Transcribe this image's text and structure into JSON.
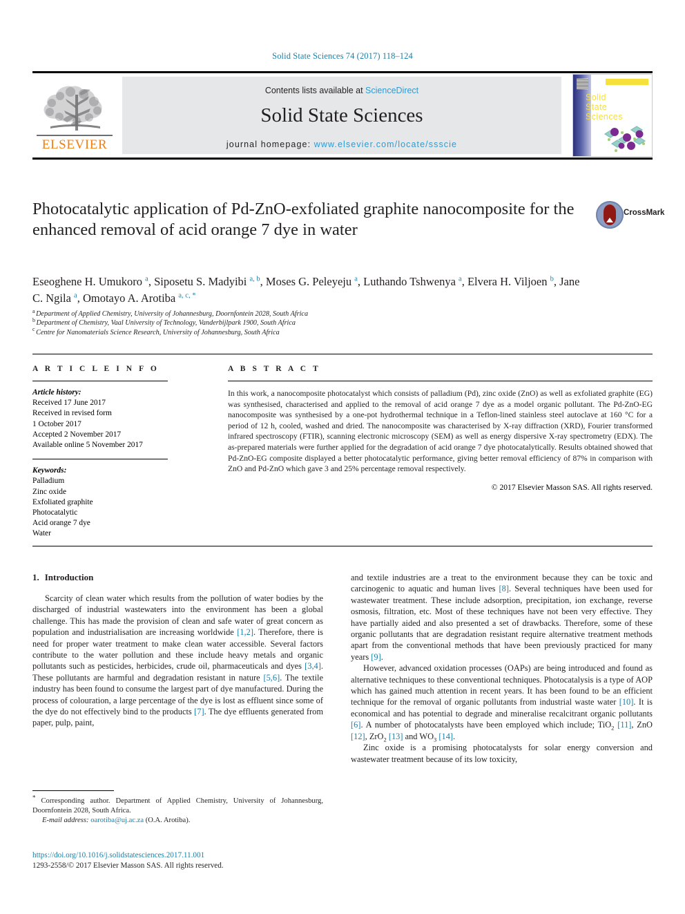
{
  "running_head": "Solid State Sciences 74 (2017) 118–124",
  "masthead": {
    "contents_label": "Contents lists available at ",
    "sciencedirect": "ScienceDirect",
    "journal_name": "Solid State Sciences",
    "homepage_label": "journal homepage: ",
    "homepage_url": "www.elsevier.com/locate/ssscie",
    "publisher_wordmark": "ELSEVIER",
    "cover_title_line1": "Solid",
    "cover_title_line2": "State",
    "cover_title_line3": "Sciences"
  },
  "badge": {
    "crossmark_label": "CrossMark"
  },
  "article": {
    "title": "Photocatalytic application of Pd-ZnO-exfoliated graphite nanocomposite for the enhanced removal of acid orange 7 dye in water",
    "authors_line1": "Eseoghene H. Umukoro",
    "authors_html": "Eseoghene H. Umukoro <sup>a</sup>, Siposetu S. Madyibi <sup>a, b</sup>, Moses G. Peleyeju <sup>a</sup>, Luthando Tshwenya <sup>a</sup>, Elvera H. Viljoen <sup>b</sup>, Jane C. Ngila <sup>a</sup>, Omotayo A. Arotiba <sup>a, c, *</sup>",
    "affiliations": [
      {
        "mark": "a",
        "text": "Department of Applied Chemistry, University of Johannesburg, Doornfontein 2028, South Africa"
      },
      {
        "mark": "b",
        "text": "Department of Chemistry, Vaal University of Technology, Vanderbijlpark 1900, South Africa"
      },
      {
        "mark": "c",
        "text": "Centre for Nanomaterials Science Research, University of Johannesburg, South Africa"
      }
    ]
  },
  "article_info": {
    "heading": "A R T I C L E  I N F O",
    "history_label": "Article history:",
    "history": [
      "Received 17 June 2017",
      "Received in revised form",
      "1 October 2017",
      "Accepted 2 November 2017",
      "Available online 5 November 2017"
    ],
    "keywords_label": "Keywords:",
    "keywords": [
      "Palladium",
      "Zinc oxide",
      "Exfoliated graphite",
      "Photocatalytic",
      "Acid orange 7 dye",
      "Water"
    ]
  },
  "abstract": {
    "heading": "A B S T R A C T",
    "body": "In this work, a nanocomposite photocatalyst which consists of palladium (Pd), zinc oxide (ZnO) as well as exfoliated graphite (EG) was synthesised, characterised and applied to the removal of acid orange 7 dye as a model organic pollutant. The Pd-ZnO-EG nanocomposite was synthesised by a one-pot hydrothermal technique in a Teflon-lined stainless steel autoclave at 160 °C for a period of 12 h, cooled, washed and dried. The nanocomposite was characterised by X-ray diffraction (XRD), Fourier transformed infrared spectroscopy (FTIR), scanning electronic microscopy (SEM) as well as energy dispersive X-ray spectrometry (EDX). The as-prepared materials were further applied for the degradation of acid orange 7 dye photocatalytically. Results obtained showed that Pd-ZnO-EG composite displayed a better photocatalytic performance, giving better removal efficiency of 87% in comparison with ZnO and Pd-ZnO which gave 3 and 25% percentage removal respectively.",
    "copyright": "© 2017 Elsevier Masson SAS. All rights reserved."
  },
  "body": {
    "section_number": "1.",
    "section_title": "Introduction",
    "left_paragraph_1": "Scarcity of clean water which results from the pollution of water bodies by the discharged of industrial wastewaters into the environment has been a global challenge. This has made the provision of clean and safe water of great concern as population and industrialisation are increasing worldwide [1,2]. Therefore, there is need for proper water treatment to make clean water accessible. Several factors contribute to the water pollution and these include heavy metals and organic pollutants such as pesticides, herbicides, crude oil, pharmaceuticals and dyes [3,4]. These pollutants are harmful and degradation resistant in nature [5,6]. The textile industry has been found to consume the largest part of dye manufactured. During the process of colouration, a large percentage of the dye is lost as effluent since some of the dye do not effectively bind to the products [7]. The dye effluents generated from paper, pulp, paint,",
    "right_paragraph_1": "and textile industries are a treat to the environment because they can be toxic and carcinogenic to aquatic and human lives [8]. Several techniques have been used for wastewater treatment. These include adsorption, precipitation, ion exchange, reverse osmosis, filtration, etc. Most of these techniques have not been very effective. They have partially aided and also presented a set of drawbacks. Therefore, some of these organic pollutants that are degradation resistant require alternative treatment methods apart from the conventional methods that have been previously practiced for many years [9].",
    "right_paragraph_2": "However, advanced oxidation processes (OAPs) are being introduced and found as alternative techniques to these conventional techniques. Photocatalysis is a type of AOP which has gained much attention in recent years. It has been found to be an efficient technique for the removal of organic pollutants from industrial waste water [10]. It is economical and has potential to degrade and mineralise recalcitrant organic pollutants [6]. A number of photocatalysts have been employed which include; TiO2 [11], ZnO [12], ZrO2 [13] and WO3 [14].",
    "right_paragraph_3": "Zinc oxide is a promising photocatalysts for solar energy conversion and wastewater treatment because of its low toxicity,"
  },
  "footnotes": {
    "corresponding": "Corresponding author. Department of Applied Chemistry, University of Johannesburg, Doornfontein 2028, South Africa.",
    "email_label": "E-mail address:",
    "email": "oarotiba@uj.ac.za",
    "email_suffix": "(O.A. Arotiba).",
    "doi": "https://doi.org/10.1016/j.solidstatesciences.2017.11.001",
    "issn_line": "1293-2558/© 2017 Elsevier Masson SAS. All rights reserved."
  },
  "colors": {
    "link_blue": "#1a7fa8",
    "sciencedirect_blue": "#2e9bd1",
    "elsevier_orange": "#f07f13",
    "cover_yellow": "#f5e03c"
  }
}
